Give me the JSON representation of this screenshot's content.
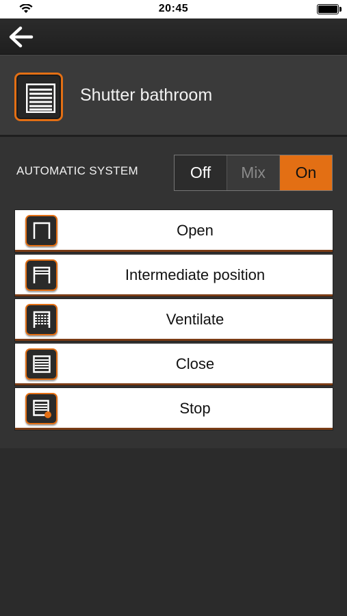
{
  "status_bar": {
    "time": "20:45"
  },
  "nav": {
    "back_icon": "arrow-left-icon"
  },
  "device": {
    "title": "Shutter bathroom",
    "icon": "shutter-icon"
  },
  "automatic_system": {
    "label": "AUTOMATIC SYSTEM",
    "options": [
      "Off",
      "Mix",
      "On"
    ],
    "selected": "On"
  },
  "actions": [
    {
      "label": "Open",
      "icon": "shutter-open-icon"
    },
    {
      "label": "Intermediate position",
      "icon": "shutter-intermediate-icon"
    },
    {
      "label": "Ventilate",
      "icon": "shutter-ventilate-icon"
    },
    {
      "label": "Close",
      "icon": "shutter-close-icon"
    },
    {
      "label": "Stop",
      "icon": "shutter-stop-icon"
    }
  ],
  "colors": {
    "accent": "#e36f14",
    "background": "#2f2f2f",
    "panel": "#3a3a3a"
  }
}
